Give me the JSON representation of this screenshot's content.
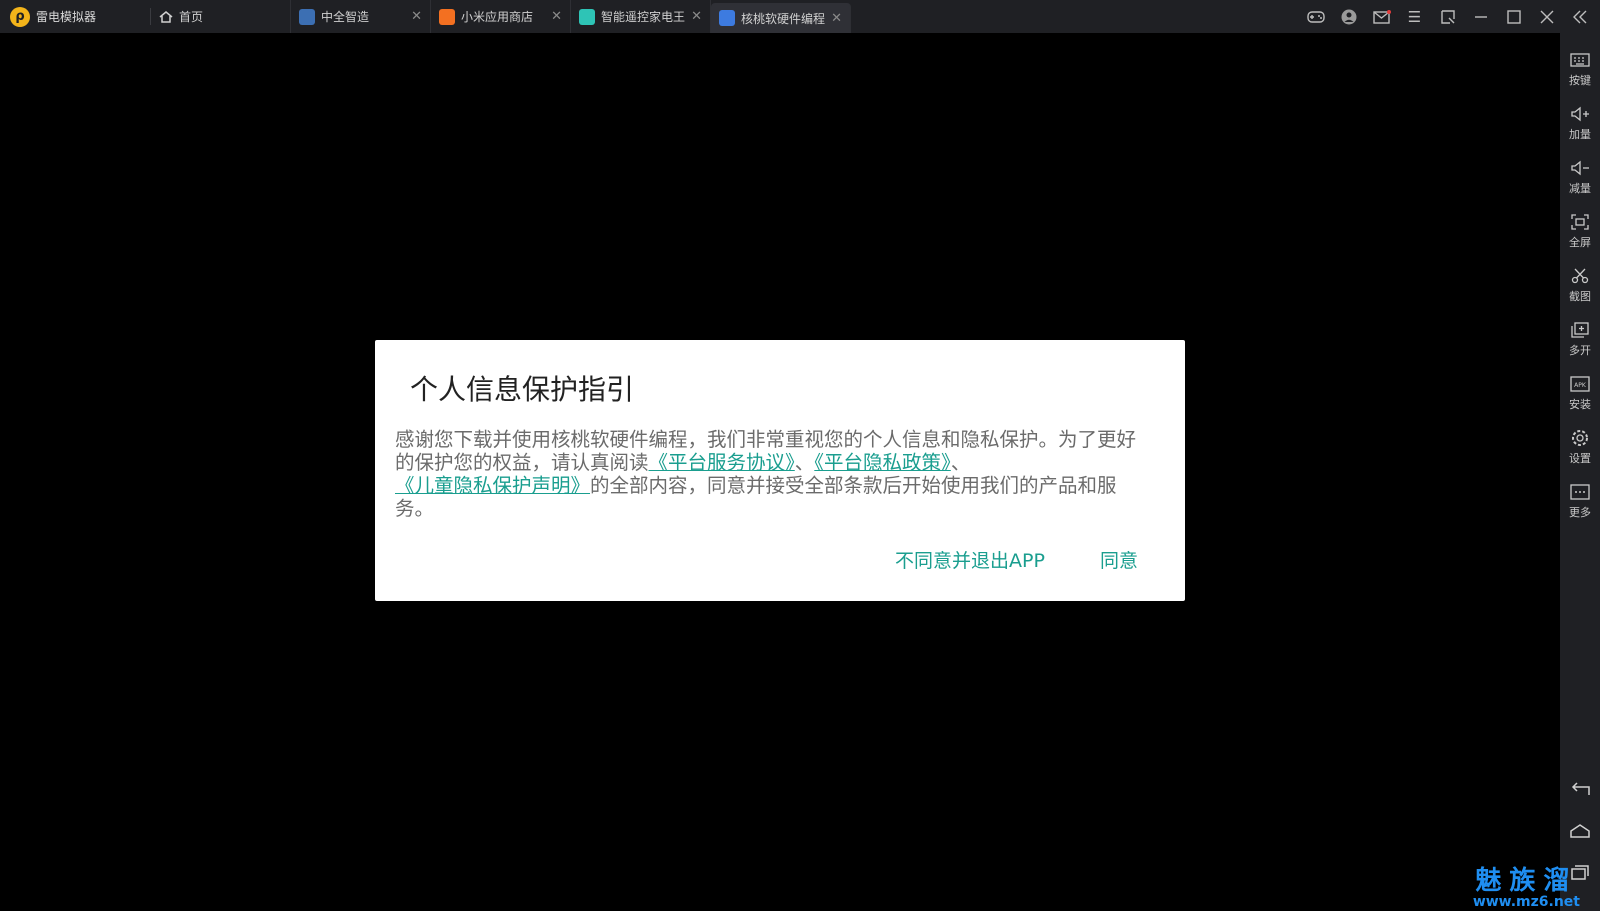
{
  "app": {
    "name": "雷电模拟器"
  },
  "tabs": [
    {
      "label": "首页",
      "closable": false
    },
    {
      "label": "中全智造",
      "closable": true,
      "color": "#3c6fb3"
    },
    {
      "label": "小米应用商店",
      "closable": true,
      "color": "#f37021"
    },
    {
      "label": "智能遥控家电王",
      "closable": true,
      "color": "#2ec4b6"
    },
    {
      "label": "核桃软硬件编程",
      "closable": true,
      "color": "#3d7be0",
      "active": true
    }
  ],
  "sidebar": {
    "items": [
      {
        "label": "按键",
        "icon": "keyboard-icon"
      },
      {
        "label": "加量",
        "icon": "volume-up-icon"
      },
      {
        "label": "减量",
        "icon": "volume-down-icon"
      },
      {
        "label": "全屏",
        "icon": "fullscreen-icon"
      },
      {
        "label": "截图",
        "icon": "scissors-icon"
      },
      {
        "label": "多开",
        "icon": "multi-instance-icon"
      },
      {
        "label": "安装",
        "icon": "apk-icon"
      },
      {
        "label": "设置",
        "icon": "gear-icon"
      },
      {
        "label": "更多",
        "icon": "more-icon"
      }
    ]
  },
  "dialog": {
    "title": "个人信息保护指引",
    "body_intro": "感谢您下载并使用核桃软硬件编程，我们非常重视您的个人信息和隐私保护。为了更好的保护您的权益，请认真阅读",
    "link_service": "《平台服务协议》",
    "sep1": "、",
    "link_privacy": "《平台隐私政策》",
    "sep2": "、",
    "link_child": "《儿童隐私保护声明》",
    "body_outro": "的全部内容，同意并接受全部条款后开始使用我们的产品和服务。",
    "disagree_label": "不同意并退出APP",
    "agree_label": "同意"
  },
  "watermark": {
    "cn": "魅族溜",
    "url": "www.mz6.net"
  },
  "colors": {
    "accent": "#1a9e8f",
    "chrome": "#1f2024"
  }
}
